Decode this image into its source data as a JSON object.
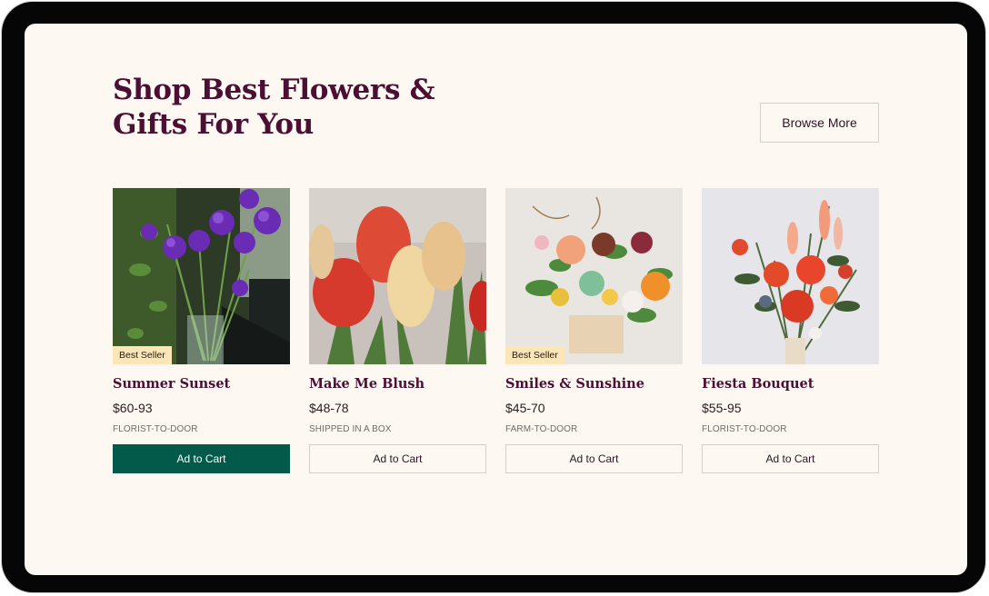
{
  "section": {
    "title": "Shop Best Flowers & Gifts For You",
    "browse_label": "Browse More"
  },
  "products": [
    {
      "name": "Summer Sunset",
      "price": "$60-93",
      "shipping": "FLORIST-TO-DOOR",
      "badge": "Best Seller",
      "cart_label": "Ad to Cart",
      "image_icon": "purple-lisianthus-photo"
    },
    {
      "name": "Make Me Blush",
      "price": "$48-78",
      "shipping": "SHIPPED IN A BOX",
      "badge": "",
      "cart_label": "Ad to Cart",
      "image_icon": "tulips-photo"
    },
    {
      "name": "Smiles & Sunshine",
      "price": "$45-70",
      "shipping": "FARM-TO-DOOR",
      "badge": "Best Seller",
      "cart_label": "Ad to Cart",
      "image_icon": "flower-box-arrangement-photo"
    },
    {
      "name": "Fiesta Bouquet",
      "price": "$55-95",
      "shipping": "FLORIST-TO-DOOR",
      "badge": "",
      "cart_label": "Ad to Cart",
      "image_icon": "red-bouquet-photo"
    }
  ],
  "colors": {
    "heading": "#4b0f33",
    "primary_button": "#035a4b",
    "background": "#fdf9f2",
    "badge": "#fbe6b8"
  }
}
